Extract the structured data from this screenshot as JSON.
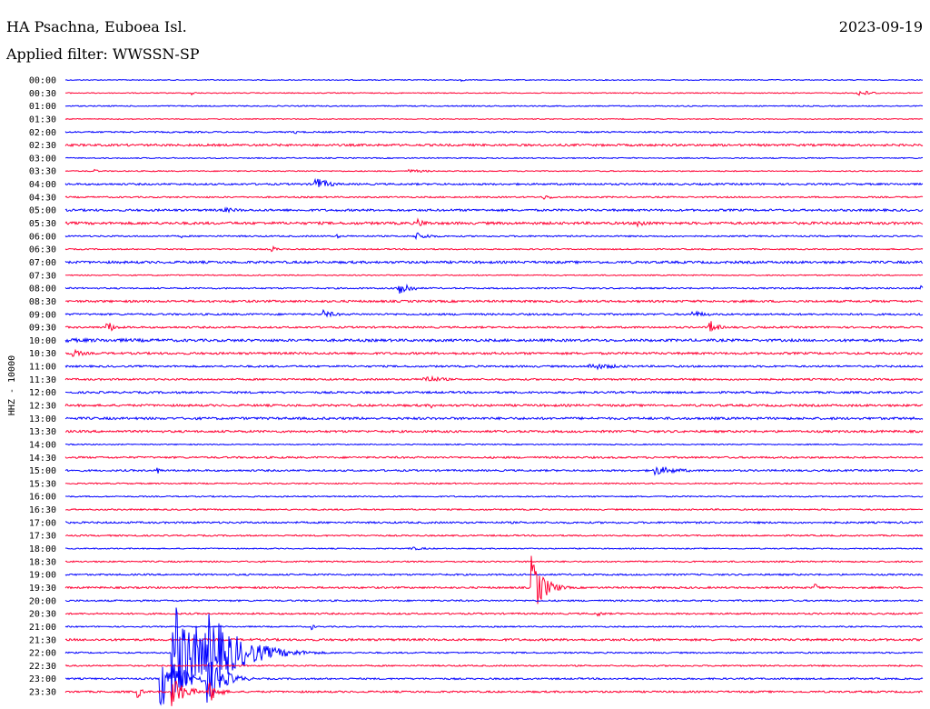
{
  "header": {
    "station": "HA Psachna, Euboea Isl.",
    "date": "2023-09-19",
    "filter": "Applied filter: WWSSN-SP"
  },
  "chart_data": {
    "type": "line",
    "ylabel": "HHZ - 10000",
    "row_labels": [
      "00:00",
      "00:30",
      "01:00",
      "01:30",
      "02:00",
      "02:30",
      "03:00",
      "03:30",
      "04:00",
      "04:30",
      "05:00",
      "05:30",
      "06:00",
      "06:30",
      "07:00",
      "07:30",
      "08:00",
      "08:30",
      "09:00",
      "09:30",
      "10:00",
      "10:30",
      "11:00",
      "11:30",
      "12:00",
      "12:30",
      "13:00",
      "13:30",
      "14:00",
      "14:30",
      "15:00",
      "15:30",
      "16:00",
      "16:30",
      "17:00",
      "17:30",
      "18:00",
      "18:30",
      "19:00",
      "19:30",
      "20:00",
      "20:30",
      "21:00",
      "21:30",
      "22:00",
      "22:30",
      "23:00",
      "23:30"
    ],
    "colors": [
      "#0000ff",
      "#ff0033"
    ],
    "x_range_minutes": [
      0,
      30
    ],
    "noise_level": [
      0.5,
      0.5,
      0.6,
      0.5,
      0.8,
      1.2,
      0.6,
      0.6,
      1.0,
      0.8,
      1.2,
      1.4,
      0.8,
      0.7,
      1.3,
      0.6,
      0.8,
      1.2,
      1.0,
      1.0,
      1.4,
      1.2,
      1.0,
      1.0,
      1.1,
      1.2,
      1.3,
      1.2,
      0.6,
      1.0,
      1.0,
      0.7,
      0.7,
      0.8,
      1.0,
      0.8,
      0.6,
      0.8,
      0.9,
      1.0,
      0.9,
      0.9,
      0.7,
      1.2,
      0.8,
      0.8,
      0.9,
      1.0
    ],
    "events": [
      {
        "row": 0,
        "t": 13.8,
        "amp": 4,
        "dur": 0.2
      },
      {
        "row": 1,
        "t": 4.4,
        "amp": 3,
        "dur": 0.3
      },
      {
        "row": 1,
        "t": 27.7,
        "amp": 4,
        "dur": 1.2
      },
      {
        "row": 4,
        "t": 8.0,
        "amp": 3,
        "dur": 0.3
      },
      {
        "row": 4,
        "t": 22.5,
        "amp": 3,
        "dur": 0.3
      },
      {
        "row": 6,
        "t": 30.0,
        "amp": 3,
        "dur": 0.2
      },
      {
        "row": 7,
        "t": 1.0,
        "amp": 3,
        "dur": 0.3
      },
      {
        "row": 7,
        "t": 12.0,
        "amp": 2,
        "dur": 2.0
      },
      {
        "row": 8,
        "t": 8.7,
        "amp": 9,
        "dur": 1.0
      },
      {
        "row": 9,
        "t": 16.7,
        "amp": 3,
        "dur": 1.0
      },
      {
        "row": 10,
        "t": 5.5,
        "amp": 3,
        "dur": 2.0
      },
      {
        "row": 11,
        "t": 12.3,
        "amp": 5,
        "dur": 1.0
      },
      {
        "row": 11,
        "t": 20.0,
        "amp": 5,
        "dur": 1.0
      },
      {
        "row": 12,
        "t": 4.0,
        "amp": 4,
        "dur": 0.2
      },
      {
        "row": 12,
        "t": 9.5,
        "amp": 3,
        "dur": 0.3
      },
      {
        "row": 12,
        "t": 12.2,
        "amp": 5,
        "dur": 1.2
      },
      {
        "row": 13,
        "t": 7.2,
        "amp": 4,
        "dur": 0.5
      },
      {
        "row": 16,
        "t": 11.6,
        "amp": 15,
        "dur": 0.7
      },
      {
        "row": 16,
        "t": 29.9,
        "amp": 4,
        "dur": 0.2
      },
      {
        "row": 18,
        "t": 9.0,
        "amp": 5,
        "dur": 1.0
      },
      {
        "row": 18,
        "t": 21.9,
        "amp": 4,
        "dur": 1.4
      },
      {
        "row": 19,
        "t": 1.4,
        "amp": 8,
        "dur": 0.7
      },
      {
        "row": 19,
        "t": 22.5,
        "amp": 10,
        "dur": 0.6
      },
      {
        "row": 20,
        "t": 0.0,
        "amp": 2,
        "dur": 30.0
      },
      {
        "row": 21,
        "t": 0.2,
        "amp": 5,
        "dur": 1.0
      },
      {
        "row": 22,
        "t": 9.3,
        "amp": 3,
        "dur": 0.3
      },
      {
        "row": 22,
        "t": 18.3,
        "amp": 4,
        "dur": 2.5
      },
      {
        "row": 23,
        "t": 12.5,
        "amp": 5,
        "dur": 1.5
      },
      {
        "row": 25,
        "t": 12.8,
        "amp": 3,
        "dur": 0.3
      },
      {
        "row": 30,
        "t": 3.2,
        "amp": 5,
        "dur": 0.3
      },
      {
        "row": 30,
        "t": 20.5,
        "amp": 6,
        "dur": 2.0
      },
      {
        "row": 35,
        "t": 2.3,
        "amp": 5,
        "dur": 0.3
      },
      {
        "row": 36,
        "t": 12.0,
        "amp": 2,
        "dur": 2.0
      },
      {
        "row": 39,
        "t": 16.3,
        "amp": 36,
        "dur": 0.9
      },
      {
        "row": 39,
        "t": 26.2,
        "amp": 6,
        "dur": 0.4
      },
      {
        "row": 41,
        "t": 18.6,
        "amp": 4,
        "dur": 0.5
      },
      {
        "row": 42,
        "t": 8.6,
        "amp": 5,
        "dur": 0.2
      },
      {
        "row": 44,
        "t": 3.7,
        "amp": 60,
        "dur": 2.8
      },
      {
        "row": 44,
        "t": 5.0,
        "amp": 45,
        "dur": 2.5
      },
      {
        "row": 46,
        "t": 3.3,
        "amp": 35,
        "dur": 1.5
      },
      {
        "row": 46,
        "t": 4.9,
        "amp": 30,
        "dur": 1.2
      },
      {
        "row": 47,
        "t": 2.5,
        "amp": 8,
        "dur": 0.4
      },
      {
        "row": 47,
        "t": 3.7,
        "amp": 20,
        "dur": 1.0
      },
      {
        "row": 47,
        "t": 5.0,
        "amp": 15,
        "dur": 0.7
      }
    ]
  }
}
